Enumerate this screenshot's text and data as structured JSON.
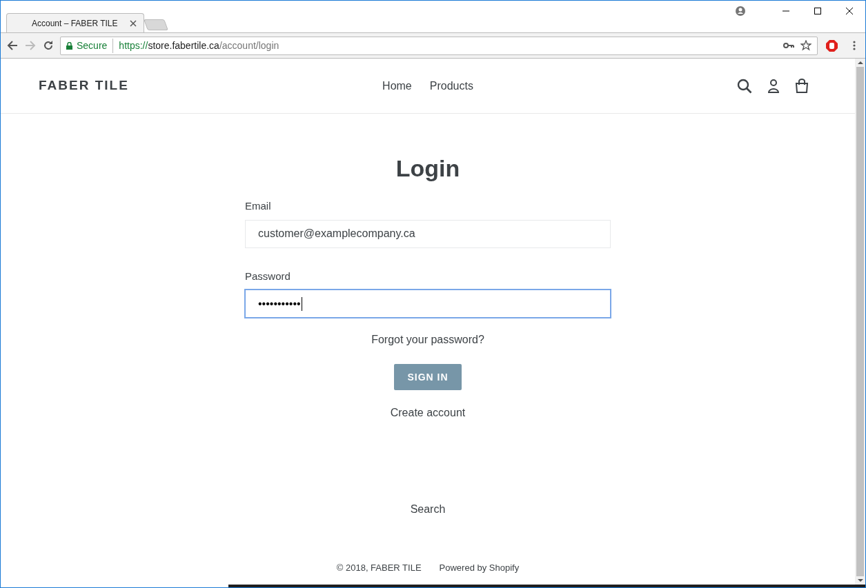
{
  "browser": {
    "tabs": [
      {
        "title": "Account – FABER TILE",
        "selected": true
      }
    ],
    "address": {
      "secure_label": "Secure",
      "scheme": "https://",
      "host": "store.fabertile.ca",
      "path": "/account/login"
    }
  },
  "header": {
    "logo": "FABER TILE",
    "nav": [
      {
        "label": "Home"
      },
      {
        "label": "Products"
      }
    ]
  },
  "login": {
    "title": "Login",
    "fields": [
      {
        "label": "Email",
        "value": "customer@examplecompany.ca",
        "focused": false
      },
      {
        "label": "Password",
        "value": "•••••••••••",
        "focused": true
      }
    ],
    "forgot_link": "Forgot your password?",
    "submit": "SIGN IN",
    "create_link": "Create account"
  },
  "footer": {
    "links": [
      "Search"
    ],
    "copyright": "© 2018, FABER TILE",
    "powered": "Powered by Shopify"
  }
}
